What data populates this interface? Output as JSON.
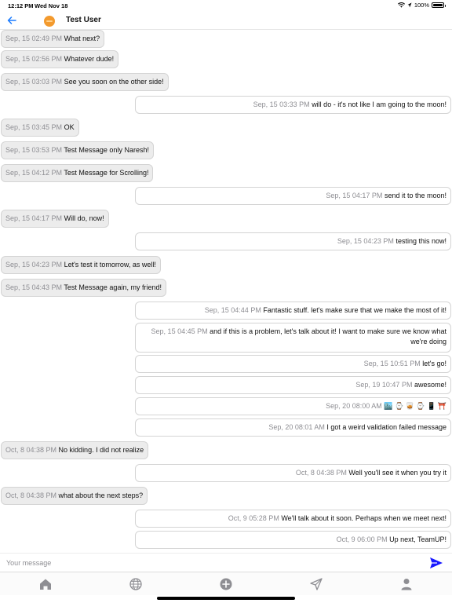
{
  "status_bar": {
    "time": "12:12 PM",
    "date": "Wed Nov 18",
    "battery": "100%",
    "battery_level": 1.0
  },
  "header": {
    "back_icon": "back-arrow-icon",
    "avatar_icon": "avatar-icon",
    "title": "Test User"
  },
  "messages": [
    {
      "dir": "in",
      "ts": "Sep, 15 02:49 PM",
      "text": "What next?"
    },
    {
      "dir": "in",
      "ts": "Sep, 15 02:56 PM",
      "text": "Whatever dude!"
    },
    {
      "dir": "in",
      "ts": "Sep, 15 03:03 PM",
      "text": "See you soon on the other side!"
    },
    {
      "dir": "out",
      "ts": "Sep, 15 03:33 PM",
      "text": "will do - it's not like I am going to the moon!"
    },
    {
      "dir": "in",
      "ts": "Sep, 15 03:45 PM",
      "text": "OK"
    },
    {
      "dir": "in",
      "ts": "Sep, 15 03:53 PM",
      "text": "Test Message only Naresh!"
    },
    {
      "dir": "in",
      "ts": "Sep, 15 04:12 PM",
      "text": "Test Message for Scrolling!"
    },
    {
      "dir": "out",
      "ts": "Sep, 15 04:17 PM",
      "text": "send it to the moon!"
    },
    {
      "dir": "in",
      "ts": "Sep, 15 04:17 PM",
      "text": "Will do, now!"
    },
    {
      "dir": "out",
      "ts": "Sep, 15 04:23 PM",
      "text": "testing this now!"
    },
    {
      "dir": "in",
      "ts": "Sep, 15 04:23 PM",
      "text": "Let's test it tomorrow, as well!"
    },
    {
      "dir": "in",
      "ts": "Sep, 15 04:43 PM",
      "text": "Test Message again, my friend!"
    },
    {
      "dir": "out",
      "ts": "Sep, 15 04:44 PM",
      "text": "Fantastic stuff. let's make sure that we make the most of it!"
    },
    {
      "dir": "out",
      "ts": "Sep, 15 04:45 PM",
      "text": "and if this is a problem, let's talk about it! I want to make sure we know what we're doing"
    },
    {
      "dir": "out",
      "ts": "Sep, 15 10:51 PM",
      "text": "let's go!"
    },
    {
      "dir": "out",
      "ts": "Sep, 19 10:47 PM",
      "text": "awesome!"
    },
    {
      "dir": "out",
      "ts": "Sep, 20 08:00 AM",
      "text": "🏙️ ⌚ 🥃 ⌚ 📱 ⛩️"
    },
    {
      "dir": "out",
      "ts": "Sep, 20 08:01 AM",
      "text": "I got a weird validation failed message"
    },
    {
      "dir": "in",
      "ts": "Oct, 8 04:38 PM",
      "text": "No kidding. I did not realize"
    },
    {
      "dir": "out",
      "ts": "Oct, 8 04:38 PM",
      "text": "Well you'll see it when you try it"
    },
    {
      "dir": "in",
      "ts": "Oct, 8 04:38 PM",
      "text": "what about the next steps?"
    },
    {
      "dir": "out",
      "ts": "Oct, 9 05:28 PM",
      "text": "We'll talk about it soon. Perhaps when we meet next!"
    },
    {
      "dir": "out",
      "ts": "Oct, 9 06:00 PM",
      "text": "Up next, TeamUP!"
    }
  ],
  "composer": {
    "placeholder": "Your message",
    "value": "",
    "send_icon": "send-icon"
  },
  "tab_bar": [
    {
      "icon": "home-icon"
    },
    {
      "icon": "globe-icon"
    },
    {
      "icon": "plus-circle-icon"
    },
    {
      "icon": "paper-plane-icon"
    },
    {
      "icon": "person-icon"
    }
  ],
  "colors": {
    "accent": "#1a1aff",
    "header_back": "#1a7bff",
    "incoming_bubble": "#ececec",
    "outgoing_bubble": "#ffffff",
    "timestamp": "#8e8e93"
  }
}
